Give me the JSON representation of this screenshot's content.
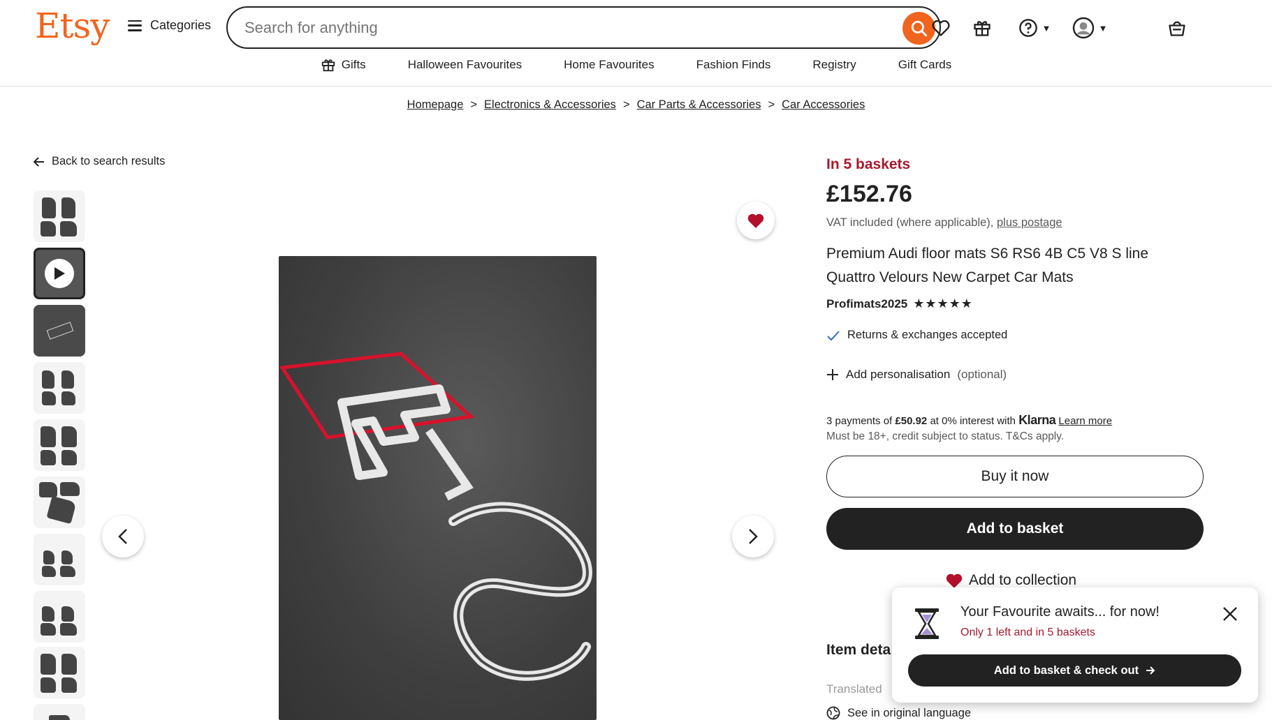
{
  "header": {
    "logo": "Etsy",
    "categories_label": "Categories",
    "search_placeholder": "Search for anything",
    "icons": [
      "heart-icon",
      "gift-icon",
      "help-icon",
      "account-icon",
      "basket-icon"
    ]
  },
  "subnav": [
    "Gifts",
    "Halloween Favourites",
    "Home Favourites",
    "Fashion Finds",
    "Registry",
    "Gift Cards"
  ],
  "breadcrumb": [
    "Homepage",
    "Electronics & Accessories",
    "Car Parts & Accessories",
    "Car Accessories"
  ],
  "back_link": "Back to search results",
  "product": {
    "baskets_notice": "In 5 baskets",
    "price": "£152.76",
    "vat_text": "VAT included (where applicable),",
    "postage_link": "plus postage",
    "title": "Premium Audi floor mats S6 RS6 4B C5 V8 S line Quattro Velours New Carpet Car Mats",
    "shop_name": "Profimats2025",
    "rating_stars": "★★★★★",
    "returns": "Returns & exchanges accepted",
    "personalisation": "Add personalisation",
    "personalisation_optional": "(optional)",
    "klarna_prefix": "3 payments of",
    "klarna_amount": "£50.92",
    "klarna_mid": "at 0% interest with",
    "klarna_brand": "Klarna",
    "klarna_learn": "Learn more",
    "klarna_note": "Must be 18+, credit subject to status. T&Cs apply.",
    "buy_now": "Buy it now",
    "add_to_basket": "Add to basket",
    "add_to_collection": "Add to collection",
    "item_details": "Item deta",
    "translated": "Translated",
    "see_original": "See in original language"
  },
  "popup": {
    "title": "Your Favourite awaits... for now!",
    "subtitle": "Only 1 left and in 5 baskets",
    "button": "Add to basket & check out"
  },
  "colors": {
    "brand": "#f1641e",
    "alert": "#a61a2e",
    "dark": "#222222"
  }
}
